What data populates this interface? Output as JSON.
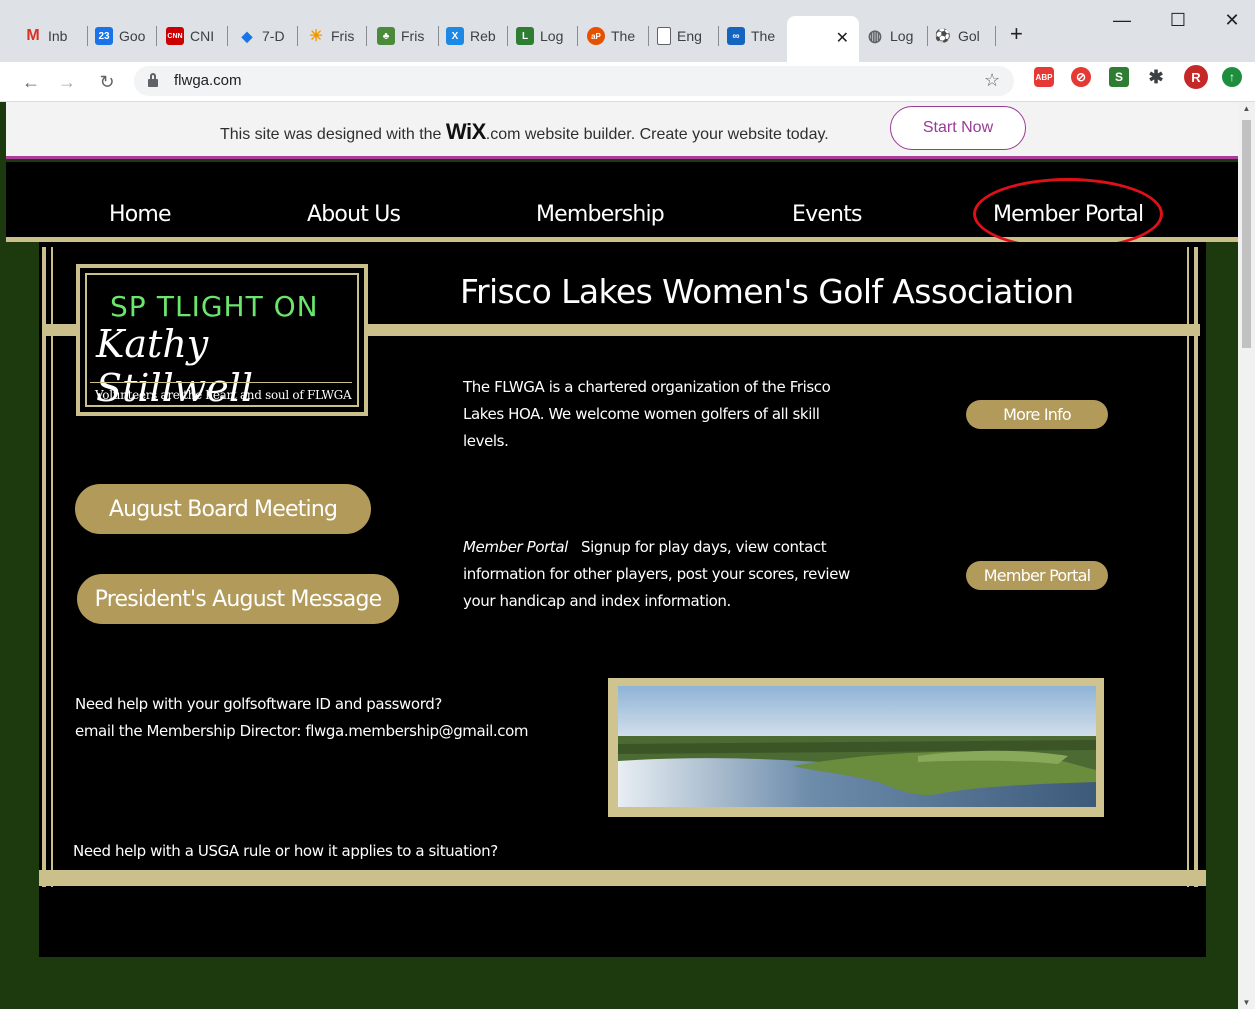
{
  "browser": {
    "tabs": [
      {
        "label": "Inb",
        "favicon": "gmail-icon",
        "color": "#d93025",
        "glyph": "M"
      },
      {
        "label": "Goo",
        "favicon": "calendar-icon",
        "color": "#1a73e8",
        "glyph": "23"
      },
      {
        "label": "CNI",
        "favicon": "cnn-icon",
        "color": "#cc0000",
        "glyph": "CNN"
      },
      {
        "label": "7-D",
        "favicon": "weather-icon",
        "color": "#1a73e8",
        "glyph": "◆"
      },
      {
        "label": "Fris",
        "favicon": "sun-icon",
        "color": "#f29900",
        "glyph": "☀"
      },
      {
        "label": "Fris",
        "favicon": "golf-club-icon",
        "color": "#4a8a3a",
        "glyph": "♣"
      },
      {
        "label": "Reb",
        "favicon": "rebounder-icon",
        "color": "#1e88e5",
        "glyph": "X"
      },
      {
        "label": "Log",
        "favicon": "logo-icon",
        "color": "#2e7d32",
        "glyph": "L"
      },
      {
        "label": "The",
        "favicon": "ap-icon",
        "color": "#e65100",
        "glyph": "aP"
      },
      {
        "label": "Eng",
        "favicon": "document-icon",
        "color": "#ffffff",
        "glyph": ""
      },
      {
        "label": "The",
        "favicon": "flickr-icon",
        "color": "#1565c0",
        "glyph": "∞"
      },
      {
        "label": "Log",
        "favicon": "globe-icon",
        "color": "#5f6368",
        "glyph": "◍"
      },
      {
        "label": "Gol",
        "favicon": "golf-icon",
        "color": "#7cb342",
        "glyph": "⚽"
      }
    ],
    "new_tab_label": "+",
    "window_controls": {
      "minimize": "—",
      "maximize": "☐",
      "close": "✕"
    },
    "url": "flwga.com",
    "extensions": [
      {
        "name": "adblock-icon",
        "color": "#e53935",
        "glyph": "ABP"
      },
      {
        "name": "ext-red-icon",
        "color": "#e53935",
        "glyph": "⊘"
      },
      {
        "name": "ext-green-icon",
        "color": "#2e7d32",
        "glyph": "S"
      },
      {
        "name": "puzzle-icon",
        "color": "#5f6368",
        "glyph": "✱"
      },
      {
        "name": "profile-avatar-icon",
        "color": "#c62828",
        "glyph": "R"
      },
      {
        "name": "update-icon",
        "color": "#1e8e3e",
        "glyph": "↑"
      }
    ]
  },
  "wix_banner": {
    "text_before": "This site was designed with the ",
    "brand": "WiX",
    "text_after": ".com website builder. Create your website today.",
    "cta": "Start Now"
  },
  "nav": {
    "items": [
      "Home",
      "About Us",
      "Membership",
      "Events",
      "Member Portal"
    ]
  },
  "spotlight": {
    "title": "SP TLIGHT ON",
    "name": "Kathy Stillwell",
    "tagline": "Volunteers are the heart and soul of FLWGA"
  },
  "main": {
    "title": "Frisco Lakes Women's Golf Association",
    "intro": "The FLWGA is a chartered organization of the Frisco Lakes HOA. We welcome women golfers of all skill levels.",
    "more_info_button": "More Info",
    "portal_label": "Member Portal",
    "portal_text": "Signup for play days, view contact information for other players, post your scores, review your handicap and index information.",
    "portal_button": "Member Portal",
    "board_meeting_button": "August Board Meeting",
    "president_button": "President's August Message",
    "help_line1": "Need help with your golfsoftware ID and password?",
    "help_line2": "email the Membership Director: flwga.membership@gmail.com",
    "usga_help": "Need help with a USGA rule or how it applies to a situation?"
  },
  "colors": {
    "gold": "#cbbf8b",
    "pill": "#b19a5a",
    "page_bg": "#1d3a0e",
    "wix_accent": "#aa3e9a",
    "annotation_circle": "#e0101a"
  }
}
